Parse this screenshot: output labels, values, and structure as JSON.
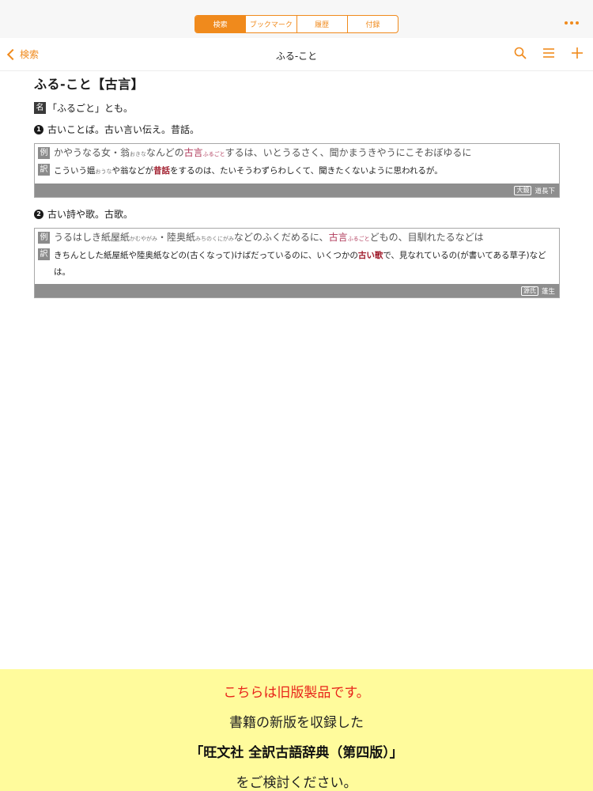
{
  "tabs": [
    {
      "label": "検索",
      "active": true
    },
    {
      "label": "ブックマーク",
      "active": false
    },
    {
      "label": "履歴",
      "active": false
    },
    {
      "label": "付録",
      "active": false
    }
  ],
  "navbar": {
    "back_label": "検索",
    "title": "ふる-こと"
  },
  "entry": {
    "headword": "ふる-こと【古言】",
    "pos_tag": "名",
    "pos_note": "「ふるごと」とも。",
    "senses": [
      {
        "num": "1",
        "definition": "古いことば。古い言い伝え。昔話。",
        "example_tag": "例",
        "example": {
          "before": "かやうなる女・翁",
          "ruby1": "おきな",
          "mid": "なんどの",
          "highlight": "古言",
          "ruby2": "ふるごと",
          "after": "するは、いとうるさく、聞かまうきやうにこそおぼゆるに"
        },
        "translation_tag": "訳",
        "translation": {
          "before": "こういう媼",
          "ruby": "おうな",
          "mid": "や翁などが",
          "bold": "昔話",
          "after": "をするのは、たいそうわずらわしくて、聞きたくないように思われるが。"
        },
        "source_book": "大鏡",
        "source_chapter": "道長下"
      },
      {
        "num": "2",
        "definition": "古い詩や歌。古歌。",
        "example_tag": "例",
        "example": {
          "before": "うるはしき紙屋紙",
          "ruby1": "かむやがみ",
          "mid1": "・陸奥紙",
          "ruby2": "みちのくにがみ",
          "mid2": "などのふくだめるに、",
          "highlight": "古言",
          "ruby3": "ふるごと",
          "after": "どもの、目馴れたるなどは"
        },
        "translation_tag": "訳",
        "translation": {
          "before": "きちんとした紙屋紙や陸奥紙などの(古くなって)けばだっているのに、いくつかの",
          "bold": "古い歌",
          "after": "で、見なれているの(が書いてある草子)などは。"
        },
        "source_book": "源氏",
        "source_chapter": "蓬生"
      }
    ]
  },
  "notice": {
    "line1": "こちらは旧版製品です。",
    "line2": "書籍の新版を収録した",
    "line3": "「旺文社 全訳古語辞典（第四版）」",
    "line4": "をご検討ください。"
  },
  "colors": {
    "accent": "#f08a1c",
    "highlight": "#b03a5b",
    "notice_bg": "#fffb9c",
    "notice_red": "#e8241a"
  },
  "icons": [
    "more-icon",
    "chevron-left-icon",
    "search-icon",
    "list-icon",
    "plus-icon"
  ]
}
